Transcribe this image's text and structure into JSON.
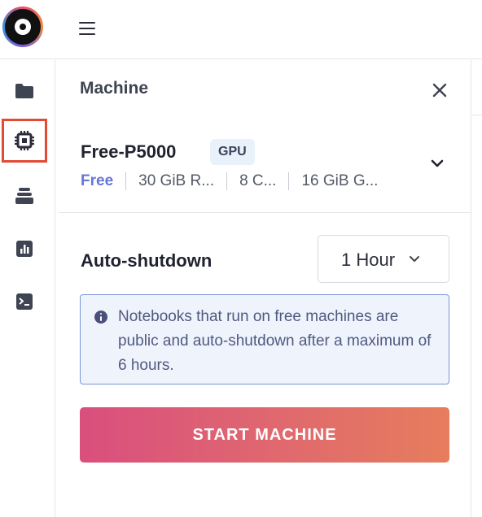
{
  "header": {
    "logo_icon": "gradient-logo-icon",
    "menu_icon": "hamburger-menu-icon"
  },
  "sidebar": {
    "items": [
      {
        "icon": "folder-icon",
        "active": false
      },
      {
        "icon": "cpu-chip-icon",
        "active": true
      },
      {
        "icon": "layers-stack-icon",
        "active": false
      },
      {
        "icon": "bar-chart-icon",
        "active": false
      },
      {
        "icon": "terminal-icon",
        "active": false
      }
    ],
    "active_color": "#e24a34"
  },
  "panel": {
    "title": "Machine",
    "close_icon": "close-icon",
    "machine": {
      "name": "Free-P5000",
      "badge": "GPU",
      "specs": [
        "Free",
        "30 GiB R...",
        "8 C...",
        "16 GiB G..."
      ],
      "expand_icon": "chevron-down-icon"
    },
    "auto_shutdown": {
      "label": "Auto-shutdown",
      "selected": "1 Hour"
    },
    "info": {
      "icon": "info-icon",
      "text": "Notebooks that run on free machines are public and auto-shutdown after a maximum of 6 hours."
    },
    "start_button": "START MACHINE"
  },
  "colors": {
    "accent_free": "#6676d8",
    "info_border": "#7c95d8",
    "button_gradient_start": "#d94f7e",
    "button_gradient_end": "#e67d5c"
  }
}
